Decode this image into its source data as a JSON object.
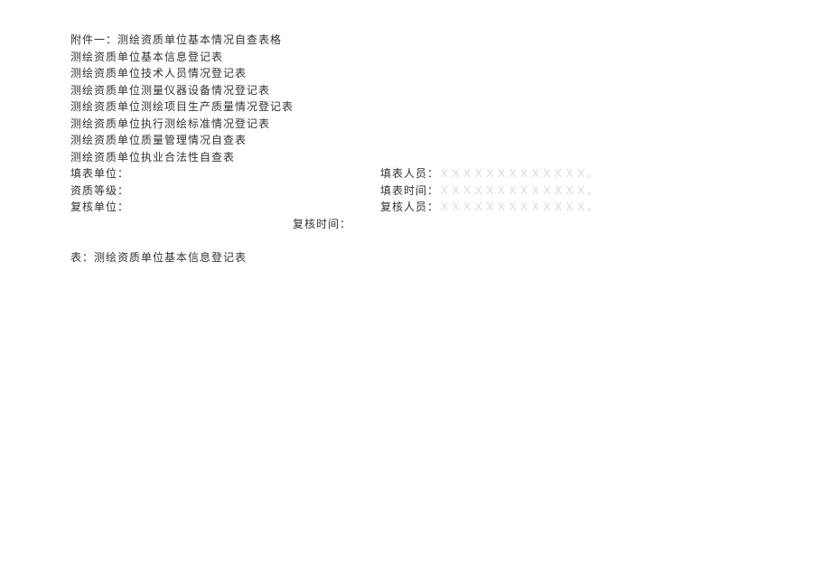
{
  "lines": {
    "l0": "附件一：测绘资质单位基本情况自查表格",
    "l1": "测绘资质单位基本信息登记表",
    "l2": "测绘资质单位技术人员情况登记表",
    "l3": "测绘资质单位测量仪器设备情况登记表",
    "l4": "测绘资质单位测绘项目生产质量情况登记表",
    "l5": "测绘资质单位执行测绘标准情况登记表",
    "l6": "测绘资质单位质量管理情况自查表",
    "l7": "测绘资质单位执业合法性自查表"
  },
  "fields": {
    "f0": {
      "label": "填表单位：",
      "rlabel": "填表人员：",
      "rvalue": "ＸＸＸＸＸＸＸＸＸＸＸＸＸ。"
    },
    "f1": {
      "label": "资质等级：",
      "rlabel": "填表时间：",
      "rvalue": "ＸＸＸＸＸＸＸＸＸＸＸＸＸ。"
    },
    "f2": {
      "label": "复核单位：",
      "rlabel": "复核人员：",
      "rvalue": "ＸＸＸＸＸＸＸＸＸＸＸＸＸ。"
    },
    "center": "复核时间："
  },
  "footer": "表：测绘资质单位基本信息登记表"
}
